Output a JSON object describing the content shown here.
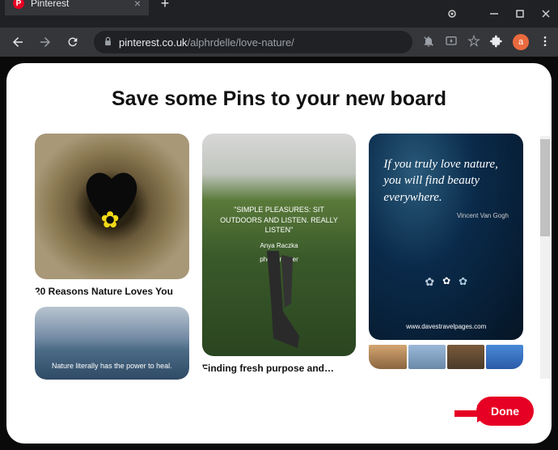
{
  "browser": {
    "tab_title": "Pinterest",
    "tab_favicon_letter": "P",
    "url_domain": "pinterest.co.uk",
    "url_path": "/alphrdelle/love-nature/",
    "avatar_letter": "a"
  },
  "modal": {
    "title": "Save some Pins to your new board",
    "done_label": "Done"
  },
  "pins": {
    "col1": {
      "pin1_caption": "20 Reasons Nature Loves You",
      "pin1b_overlay": "Nature literally has the power to heal."
    },
    "col2": {
      "pin2_quote": "\"SIMPLE PLEASURES: SIT OUTDOORS AND LISTEN. REALLY LISTEN\"",
      "pin2_author": "Anya Raczka",
      "pin2_role": "photographer",
      "pin2_caption": "Finding fresh purpose and…"
    },
    "col3": {
      "pin3_quote": "If you truly love nature, you will find beauty everywhere.",
      "pin3_author": "Vincent Van Gogh",
      "pin3_site": "www.davestravelpages.com"
    }
  }
}
